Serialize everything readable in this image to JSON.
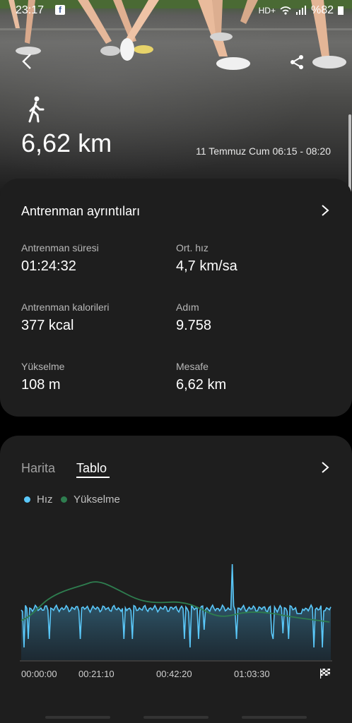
{
  "status_bar": {
    "time": "23:17",
    "network": "HD+",
    "battery": "%82"
  },
  "header": {
    "distance": "6,62 km",
    "datetime": "11 Temmuz Cum 06:15 - 08:20",
    "icons": {
      "back": "chevron-left-icon",
      "share": "share-icon",
      "activity": "walking-icon"
    }
  },
  "details": {
    "title": "Antrenman ayrıntıları",
    "metrics": [
      {
        "label": "Antrenman süresi",
        "value": "01:24:32"
      },
      {
        "label": "Ort. hız",
        "value": "4,7 km/sa"
      },
      {
        "label": "Antrenman kalorileri",
        "value": "377 kcal"
      },
      {
        "label": "Adım",
        "value": "9.758"
      },
      {
        "label": "Yükselme",
        "value": "108 m"
      },
      {
        "label": "Mesafe",
        "value": "6,62 km"
      }
    ]
  },
  "chart_card": {
    "tabs": [
      "Harita",
      "Tablo"
    ],
    "active_tab": "Tablo"
  },
  "chart_data": {
    "type": "area",
    "series": [
      {
        "name": "Hız",
        "color": "#5ac8fa"
      },
      {
        "name": "Yükselme",
        "color": "#2e7d4f"
      }
    ],
    "x_ticks": [
      "00:00:00",
      "00:21:10",
      "00:42:20",
      "01:03:30"
    ],
    "grid": false
  }
}
